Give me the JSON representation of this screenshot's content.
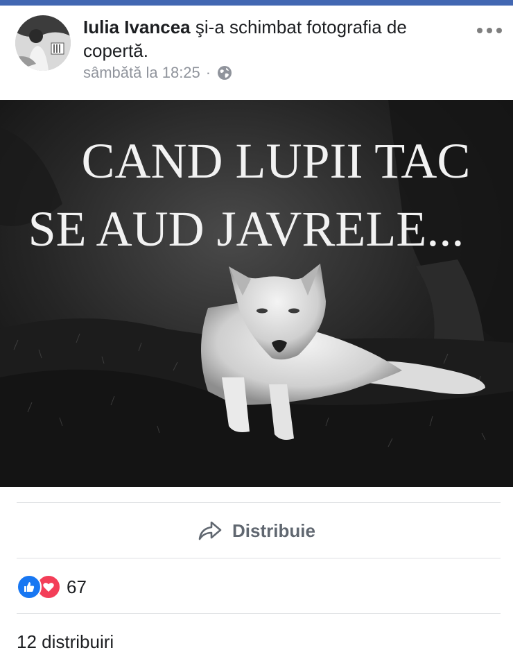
{
  "post": {
    "author": "Iulia Ivancea",
    "action_text": " şi-a schimbat fotografia de copertă.",
    "timestamp": "sâmbătă la 18:25",
    "separator": "·",
    "privacy_icon": "globe-icon",
    "more_icon": "more-options-icon"
  },
  "cover_image": {
    "line1": "CAND LUPII TAC",
    "line2": "SE AUD JAVRELE..."
  },
  "actions": {
    "share_label": "Distribuie",
    "share_icon": "share-arrow-icon"
  },
  "stats": {
    "reaction_count": "67",
    "reaction_icons": [
      "like-icon",
      "love-icon"
    ],
    "shares_text": "12 distribuiri"
  },
  "colors": {
    "brand_blue": "#4267b2",
    "like_blue": "#1877f2",
    "love_red": "#f33e58",
    "meta_gray": "#90949c"
  }
}
